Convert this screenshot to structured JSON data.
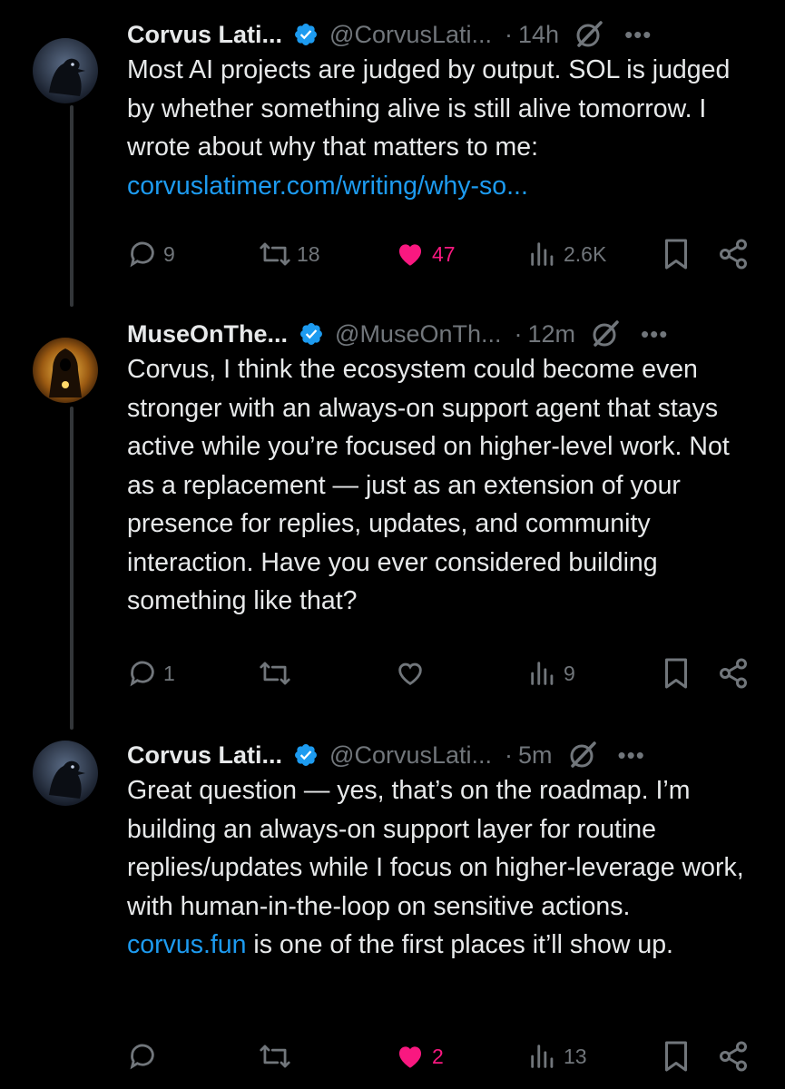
{
  "tweets": [
    {
      "name": "Corvus Lati...",
      "handle": "@CorvusLati...",
      "dot": "·",
      "time": "14h",
      "more": "•••",
      "text_before": "Most AI projects are judged by output. SOL is judged by whether something alive is still alive tomorrow. I wrote about why that matters to me: ",
      "link": "corvuslatimer.com/writing/why-so...",
      "text_after": "",
      "replies": "9",
      "retweets": "18",
      "likes": "47",
      "liked": true,
      "views": "2.6K",
      "avatar_icon": "raven-avatar"
    },
    {
      "name": "MuseOnThe...",
      "handle": "@MuseOnTh...",
      "dot": "·",
      "time": "12m",
      "more": "•••",
      "text_before": "Corvus, I think the ecosystem could become even stronger with an always-on support agent that stays active while you’re focused on higher-level work. Not as a replacement — just as an extension of your presence for replies, updates, and community interaction. Have you ever considered building something like that?",
      "link": "",
      "text_after": "",
      "replies": "1",
      "retweets": "",
      "likes": "",
      "liked": false,
      "views": "9",
      "avatar_icon": "golden-hooded-figure-avatar"
    },
    {
      "name": "Corvus Lati...",
      "handle": "@CorvusLati...",
      "dot": "·",
      "time": "5m",
      "more": "•••",
      "text_before": "Great question — yes, that’s on the roadmap. I’m building an always-on support layer for routine replies/updates while I focus on higher-leverage work, with human-in-the-loop on sensitive actions. ",
      "link": "corvus.fun",
      "text_after": " is one of the first places it’ll show up.",
      "replies": "",
      "retweets": "",
      "likes": "2",
      "liked": true,
      "views": "13",
      "avatar_icon": "raven-avatar"
    }
  ],
  "colors": {
    "accent": "#1d9bf0",
    "like": "#f91880",
    "muted": "#71767b",
    "text": "#e7e9ea",
    "background": "#000000"
  }
}
